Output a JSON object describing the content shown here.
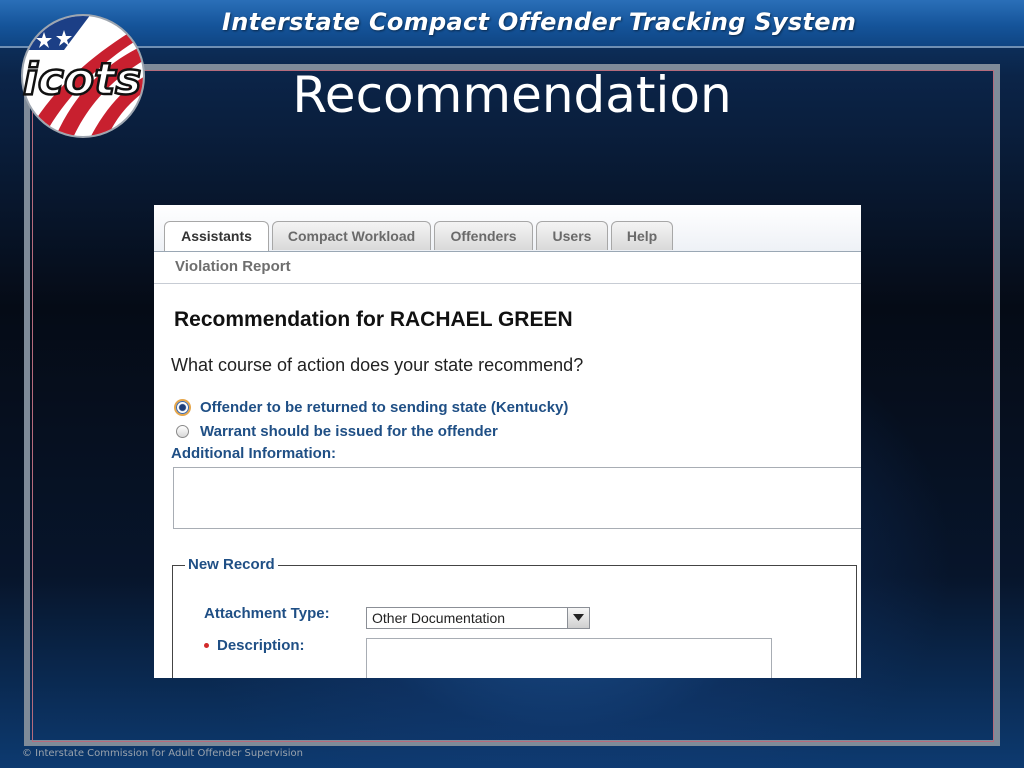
{
  "header": {
    "app_title": "Interstate Compact Offender Tracking System",
    "logo_text": "icots"
  },
  "slide": {
    "title": "Recommendation",
    "footer": "© Interstate Commission for Adult Offender Supervision"
  },
  "tabs": [
    {
      "label": "Assistants",
      "active": true
    },
    {
      "label": "Compact Workload",
      "active": false
    },
    {
      "label": "Offenders",
      "active": false
    },
    {
      "label": "Users",
      "active": false
    },
    {
      "label": "Help",
      "active": false
    }
  ],
  "subnav": {
    "link": "Violation Report"
  },
  "form": {
    "heading": "Recommendation for RACHAEL GREEN",
    "question": "What course of action does your state recommend?",
    "options": [
      {
        "label": "Offender to be returned to sending state (Kentucky)",
        "checked": true
      },
      {
        "label": "Warrant should be issued for the offender",
        "checked": false
      }
    ],
    "additional_label": "Additional Information:",
    "additional_value": "",
    "new_record": {
      "legend": "New Record",
      "attachment_type_label": "Attachment Type:",
      "attachment_type_value": "Other Documentation",
      "description_label": "Description:",
      "description_value": ""
    }
  },
  "colors": {
    "label_blue": "#1f4f85",
    "required_red": "#d22a2a",
    "topbar_blue": "#15549a"
  },
  "icons": [
    "star-icon",
    "chevron-down-icon",
    "radio-checked",
    "radio-unchecked"
  ]
}
